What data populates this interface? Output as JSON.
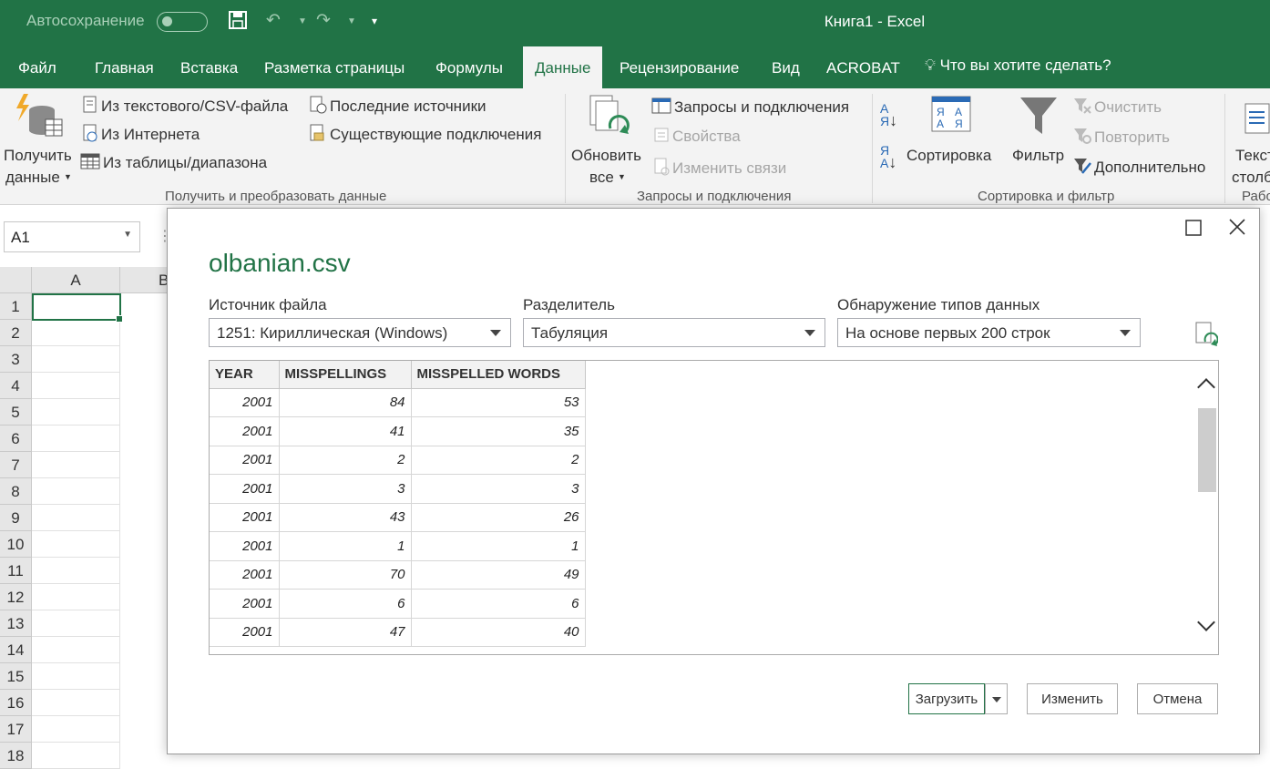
{
  "titlebar": {
    "autosave_label": "Автосохранение",
    "window_title": "Книга1  -  Excel"
  },
  "tabs": {
    "items": [
      "Файл",
      "Главная",
      "Вставка",
      "Разметка страницы",
      "Формулы",
      "Данные",
      "Рецензирование",
      "Вид",
      "ACROBAT"
    ],
    "active": "Данные",
    "tell_me": "Что вы хотите сделать?"
  },
  "ribbon": {
    "get_data_line1": "Получить",
    "get_data_line2": "данные",
    "from_text": "Из текстового/CSV-файла",
    "from_web": "Из Интернета",
    "from_table": "Из таблицы/диапазона",
    "recent_sources": "Последние источники",
    "existing_conn": "Существующие подключения",
    "group_get": "Получить и преобразовать данные",
    "refresh_line1": "Обновить",
    "refresh_line2": "все",
    "queries_conn": "Запросы и подключения",
    "properties": "Свойства",
    "edit_links": "Изменить связи",
    "group_queries": "Запросы и подключения",
    "sort": "Сортировка",
    "filter": "Фильтр",
    "clear": "Очистить",
    "reapply": "Повторить",
    "advanced": "Дополнительно",
    "group_sort": "Сортировка и фильтр",
    "text_cols_1": "Текст",
    "text_cols_2": "столб",
    "group_tools": "Рабо"
  },
  "sheet": {
    "namebox": "A1",
    "col_a": "A",
    "col_b": "B",
    "rows": [
      "1",
      "2",
      "3",
      "4",
      "5",
      "6",
      "7",
      "8",
      "9",
      "10",
      "11",
      "12",
      "13",
      "14",
      "15",
      "16",
      "17",
      "18"
    ]
  },
  "dialog": {
    "title": "olbanian.csv",
    "file_origin_label": "Источник файла",
    "file_origin_value": "1251: Кириллическая (Windows)",
    "delimiter_label": "Разделитель",
    "delimiter_value": "Табуляция",
    "detect_label": "Обнаружение типов данных",
    "detect_value": "На основе первых 200 строк",
    "columns": [
      "YEAR",
      "MISSPELLINGS",
      "MISSPELLED WORDS"
    ],
    "rows": [
      [
        "2001",
        "84",
        "53"
      ],
      [
        "2001",
        "41",
        "35"
      ],
      [
        "2001",
        "2",
        "2"
      ],
      [
        "2001",
        "3",
        "3"
      ],
      [
        "2001",
        "43",
        "26"
      ],
      [
        "2001",
        "1",
        "1"
      ],
      [
        "2001",
        "70",
        "49"
      ],
      [
        "2001",
        "6",
        "6"
      ],
      [
        "2001",
        "47",
        "40"
      ]
    ],
    "load_button": "Загрузить",
    "edit_button": "Изменить",
    "cancel_button": "Отмена"
  },
  "colors": {
    "excel_green": "#217346",
    "ribbon_bg": "#f3f3f3"
  }
}
